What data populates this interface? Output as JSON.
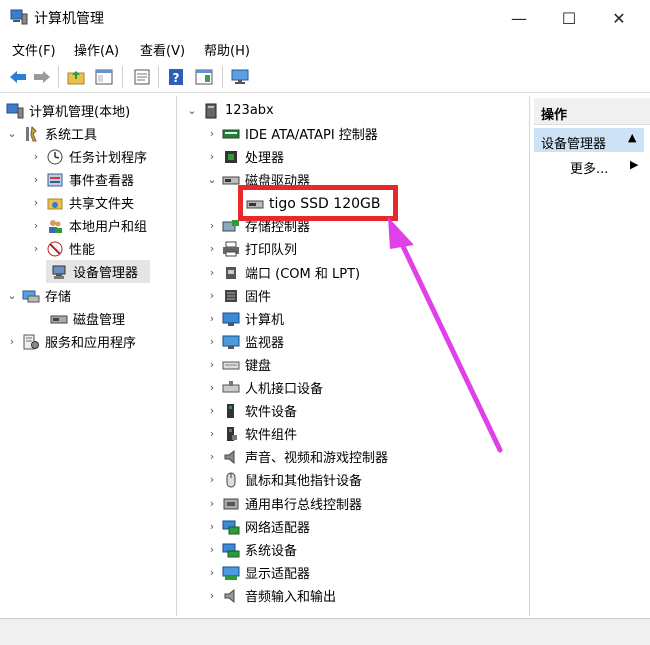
{
  "window": {
    "title": "计算机管理",
    "minimize": "—",
    "maximize": "☐",
    "close": "✕"
  },
  "menu": [
    "文件(F)",
    "操作(A)",
    "查看(V)",
    "帮助(H)"
  ],
  "left_tree": [
    {
      "label": "计算机管理(本地)",
      "icon": "computer-management-icon"
    },
    {
      "label": "系统工具",
      "icon": "tools-icon"
    },
    {
      "label": "任务计划程序",
      "icon": "clock-icon"
    },
    {
      "label": "事件查看器",
      "icon": "event-viewer-icon"
    },
    {
      "label": "共享文件夹",
      "icon": "shared-folder-icon"
    },
    {
      "label": "本地用户和组",
      "icon": "users-icon"
    },
    {
      "label": "性能",
      "icon": "performance-icon"
    },
    {
      "label": "设备管理器",
      "icon": "device-manager-icon"
    },
    {
      "label": "存储",
      "icon": "storage-icon"
    },
    {
      "label": "磁盘管理",
      "icon": "disk-management-icon"
    },
    {
      "label": "服务和应用程序",
      "icon": "services-icon"
    }
  ],
  "device_tree": {
    "root": "123abx",
    "disk_child": "tigo SSD 120GB",
    "categories": [
      {
        "label": "IDE ATA/ATAPI 控制器",
        "icon": "ide-controller-icon"
      },
      {
        "label": "处理器",
        "icon": "processor-icon"
      },
      {
        "label": "磁盘驱动器",
        "icon": "disk-drive-icon"
      },
      {
        "label": "存储控制器",
        "icon": "storage-controller-icon"
      },
      {
        "label": "打印队列",
        "icon": "printer-icon"
      },
      {
        "label": "端口 (COM 和 LPT)",
        "icon": "port-icon"
      },
      {
        "label": "固件",
        "icon": "firmware-icon"
      },
      {
        "label": "计算机",
        "icon": "computer-icon"
      },
      {
        "label": "监视器",
        "icon": "monitor-icon"
      },
      {
        "label": "键盘",
        "icon": "keyboard-icon"
      },
      {
        "label": "人机接口设备",
        "icon": "hid-icon"
      },
      {
        "label": "软件设备",
        "icon": "software-device-icon"
      },
      {
        "label": "软件组件",
        "icon": "software-component-icon"
      },
      {
        "label": "声音、视频和游戏控制器",
        "icon": "sound-icon"
      },
      {
        "label": "鼠标和其他指针设备",
        "icon": "mouse-icon"
      },
      {
        "label": "通用串行总线控制器",
        "icon": "usb-icon"
      },
      {
        "label": "网络适配器",
        "icon": "network-icon"
      },
      {
        "label": "系统设备",
        "icon": "system-device-icon"
      },
      {
        "label": "显示适配器",
        "icon": "display-adapter-icon"
      },
      {
        "label": "音频输入和输出",
        "icon": "audio-io-icon"
      }
    ]
  },
  "actions": {
    "header": "操作",
    "section": "设备管理器",
    "more": "更多..."
  },
  "colors": {
    "highlight": "#e8282a",
    "arrow": "#e040e8",
    "selection": "#cde3f5"
  }
}
